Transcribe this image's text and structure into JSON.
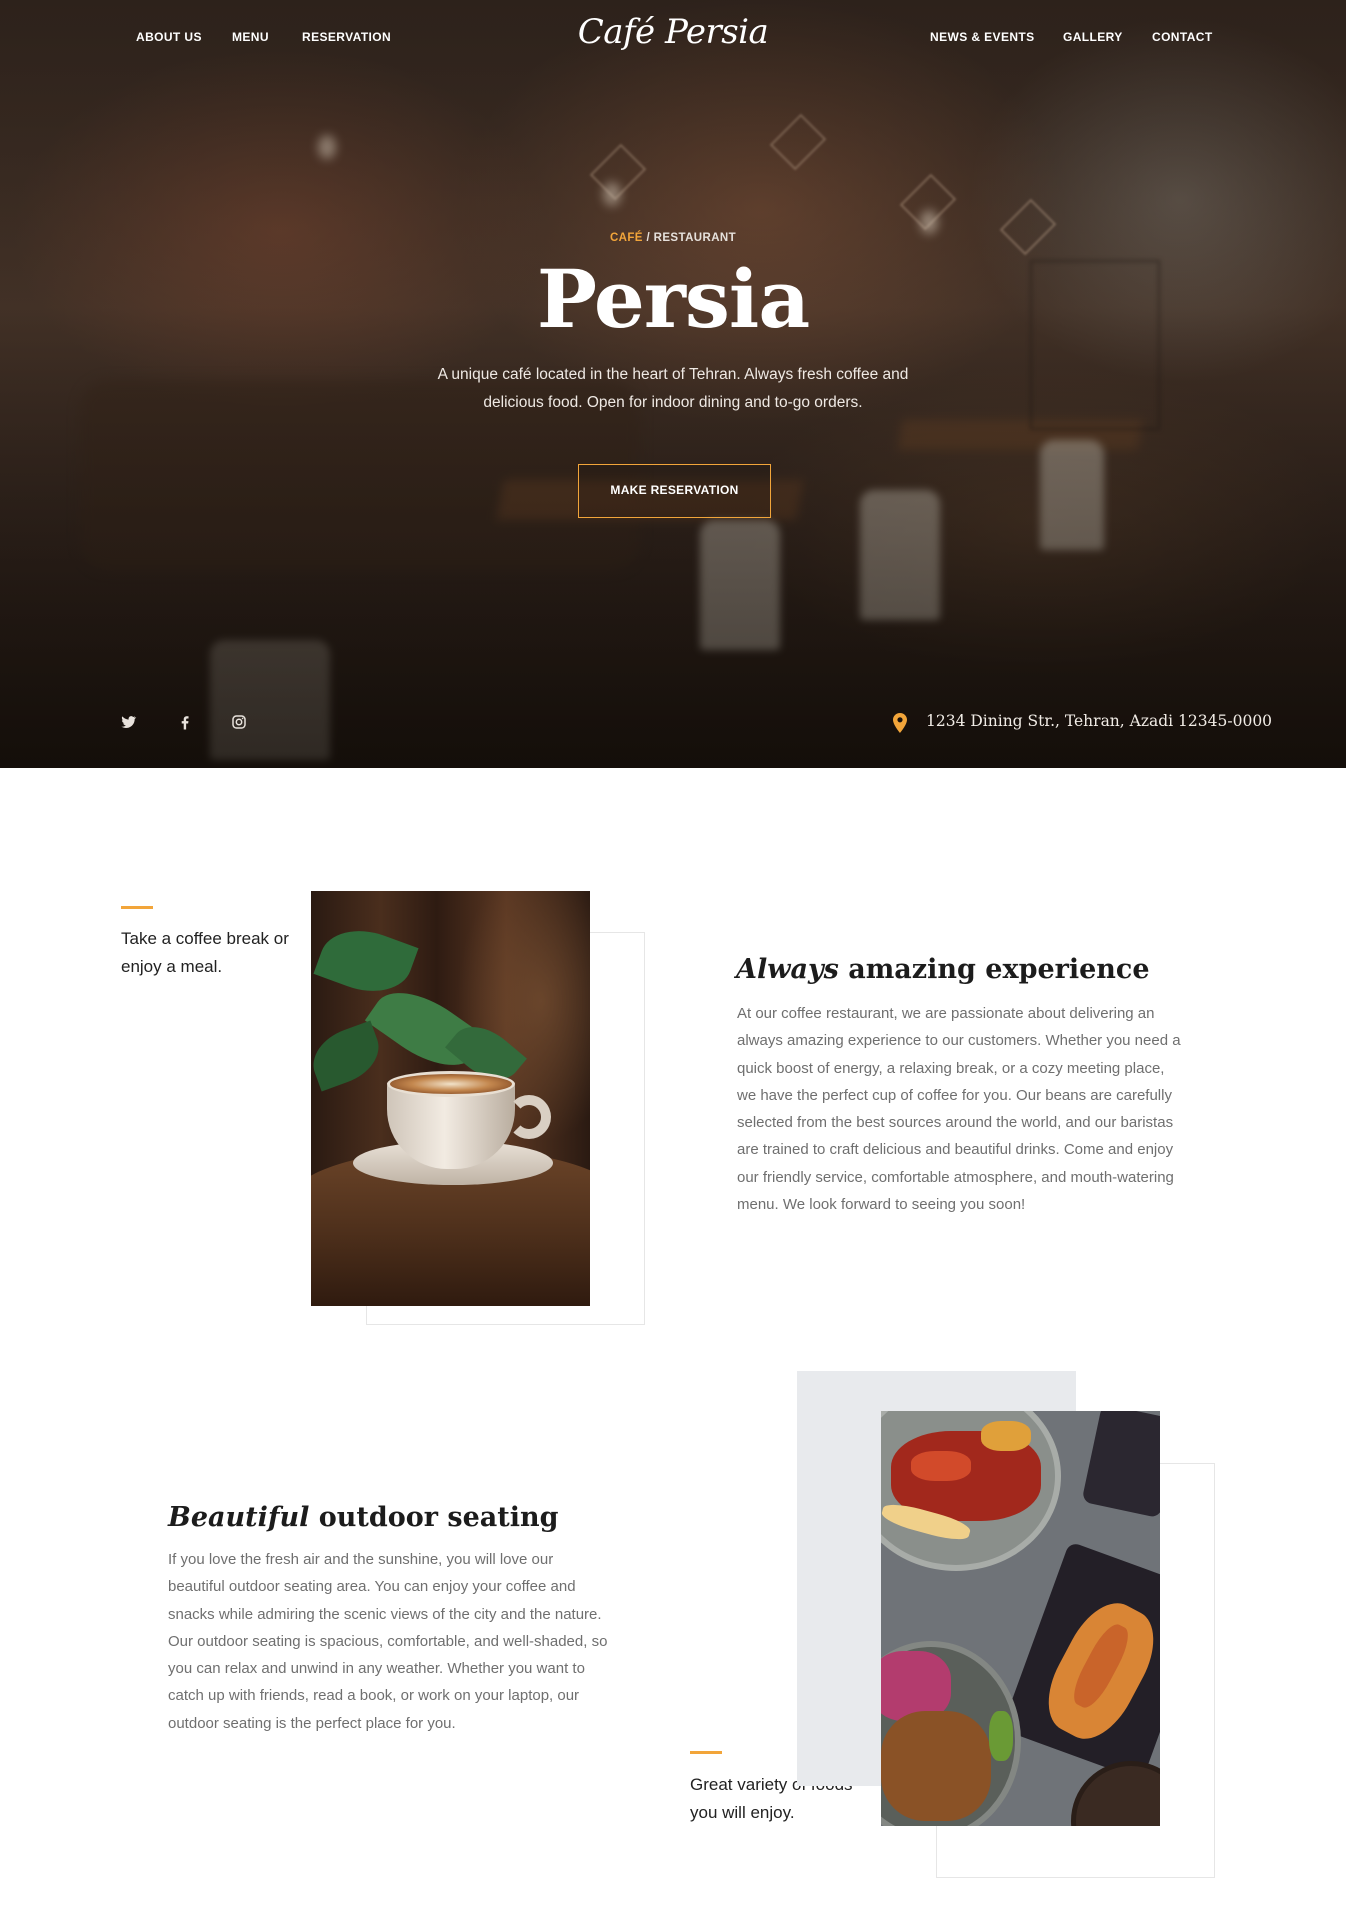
{
  "colors": {
    "accent": "#f2a53a",
    "body_text": "#6f6f6f",
    "heading_text": "#1c1c1c",
    "grey_block": "#e8eaed"
  },
  "nav": {
    "left": [
      "ABOUT US",
      "MENU",
      "RESERVATION"
    ],
    "right": [
      "NEWS & EVENTS",
      "GALLERY",
      "CONTACT"
    ],
    "brand": "Café Persia"
  },
  "hero": {
    "kicker_accent": "CAFÉ",
    "kicker_rest": " / RESTAURANT",
    "title": "Persia",
    "description": "A unique café located in the heart of Tehran. Always fresh coffee and delicious food. Open for indoor dining and to-go orders.",
    "button_label": "MAKE RESERVATION",
    "social_icons": [
      "twitter-icon",
      "facebook-icon",
      "instagram-icon"
    ],
    "address_icon": "map-pin-icon",
    "address": "1234 Dining Str., Tehran, Azadi 12345-0000"
  },
  "section_experience": {
    "side_note": "Take a coffee break or enjoy a meal.",
    "title_italic": "Always",
    "title_rest": " amazing experience",
    "body": "At our coffee restaurant, we are passionate about delivering an always amazing experience to our customers. Whether you need a quick boost of energy, a relaxing break, or a cozy meeting place, we have the perfect cup of coffee for you. Our beans are carefully selected from the best sources around the world, and our baristas are trained to craft delicious and beautiful drinks. Come and enjoy our friendly service, comfortable atmosphere, and mouth-watering menu. We look forward to seeing you soon!"
  },
  "section_outdoor": {
    "title_italic": "Beautiful",
    "title_rest": " outdoor seating",
    "body": "If you love the fresh air and the sunshine, you will love our beautiful outdoor seating area. You can enjoy your coffee and snacks while admiring the scenic views of the city and the nature. Our outdoor seating is spacious, comfortable, and well-shaded, so you can relax and unwind in any weather. Whether you want to catch up with friends, read a book, or work on your laptop, our outdoor seating is the perfect place for you.",
    "side_note": "Great variety of foods you will enjoy."
  }
}
